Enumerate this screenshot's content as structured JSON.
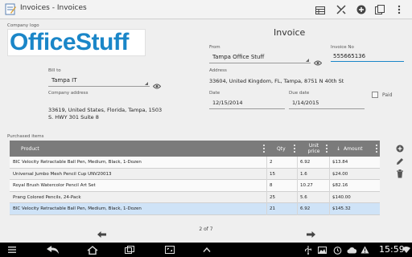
{
  "app": {
    "title": "Invoices - Invoices"
  },
  "invoice": {
    "heading": "Invoice",
    "company_logo_label": "Company logo",
    "logo_text": "OfficeStuff",
    "from_label": "From",
    "from_value": "Tampa Office Stuff",
    "invoice_no_label": "Invoice No",
    "invoice_no_value": "555665136",
    "bill_to_label": "Bill to",
    "bill_to_value": "Tampa IT",
    "address_label": "Address",
    "address_value": "33604, United Kingdom, FL, Tampa, 8751 N 40th St",
    "company_address_label": "Company address",
    "company_address_line1": "33619, United States, Florida, Tampa, 1503",
    "company_address_line2": "S. HWY 301 Suite 8",
    "date_label": "Date",
    "date_value": "12/15/2014",
    "due_date_label": "Due date",
    "due_date_value": "1/14/2015",
    "paid_label": "Paid",
    "paid_checked": false,
    "purchased_items_label": "Purchased items"
  },
  "table": {
    "columns": {
      "product": "Product",
      "qty": "Qty",
      "unit_price_line1": "Unit",
      "unit_price_line2": "price",
      "amount": "Amount",
      "amount_sort": "↓"
    },
    "rows": [
      {
        "product": "BIC Velocity Retractable Ball Pen, Medium, Black, 1-Dozen",
        "qty": "2",
        "unit_price": "6.92",
        "amount": "$13.84"
      },
      {
        "product": "Universal Jumbo Mesh Pencil Cup UNV20013",
        "qty": "15",
        "unit_price": "1.6",
        "amount": "$24.00"
      },
      {
        "product": "Royal Brush Watercolor Pencil Art Set",
        "qty": "8",
        "unit_price": "10.27",
        "amount": "$82.16"
      },
      {
        "product": "Prang Colored Pencils, 24-Pack",
        "qty": "25",
        "unit_price": "5.6",
        "amount": "$140.00"
      },
      {
        "product": "BIC Velocity Retractable Ball Pen, Medium, Black, 1-Dozen",
        "qty": "21",
        "unit_price": "6.92",
        "amount": "$145.32"
      }
    ]
  },
  "pager": {
    "label": "2 of 7"
  },
  "status": {
    "time": "15:59"
  },
  "colors": {
    "accent": "#1a86c8",
    "header_bg": "#7b7b7b",
    "selected_row": "#cfe3f7"
  }
}
